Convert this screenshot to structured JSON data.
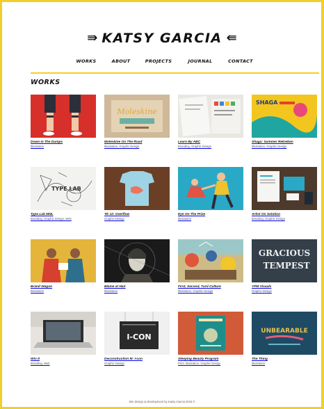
{
  "site": {
    "logo_text": "KATSY GARCIA",
    "accent_color": "#f1cf2a"
  },
  "nav": [
    {
      "label": "WORKS"
    },
    {
      "label": "ABOUT"
    },
    {
      "label": "PROJECTS"
    },
    {
      "label": "JOURNAL"
    },
    {
      "label": "CONTACT"
    }
  ],
  "section": {
    "title": "WORKS"
  },
  "works": [
    {
      "title": "Down In The Dumps",
      "category": "Illustration"
    },
    {
      "title": "Moleskine On The Road",
      "category": "Illustration, Graphic Design"
    },
    {
      "title": "Learn By ABC",
      "category": "Branding, Graphic Design"
    },
    {
      "title": "Shaga: Summer Rekreben",
      "category": "Illustration, Graphic Design"
    },
    {
      "title": "Type Lab MNL",
      "category": "Branding, Graphic Design, Web"
    },
    {
      "title": "TE 12: Overflow",
      "category": "Graphic Design"
    },
    {
      "title": "Eye On The Prize",
      "category": "Illustration"
    },
    {
      "title": "Artist On Solution",
      "category": "Branding, Graphic Design"
    },
    {
      "title": "Brand Wagon",
      "category": "Illustration"
    },
    {
      "title": "Blame at Hair",
      "category": "Illustration"
    },
    {
      "title": "First, Second, Turd Culture",
      "category": "Illustration, Graphic Design"
    },
    {
      "title": "YPM Visuals",
      "category": "Graphic Design"
    },
    {
      "title": "Win It",
      "category": "Branding, Web"
    },
    {
      "title": "Deconstruction III: I-con",
      "category": "Graphic Design"
    },
    {
      "title": "Sleeping Beauty Program",
      "category": "Print, Illustration, Graphic Design"
    },
    {
      "title": "The Thing",
      "category": "Illustration"
    }
  ],
  "thumb_text": {
    "moleskine": "Moleskine",
    "shaga": "SHAGA",
    "typelab": "TYPE LAB",
    "gracious": "GRACIOUS",
    "tempest": "TEMPEST",
    "icon": "I-CON",
    "unbearable": "UNBEARABLE"
  },
  "footer": {
    "text": "Site design & development by Katsy Garcia 2015 ©"
  }
}
